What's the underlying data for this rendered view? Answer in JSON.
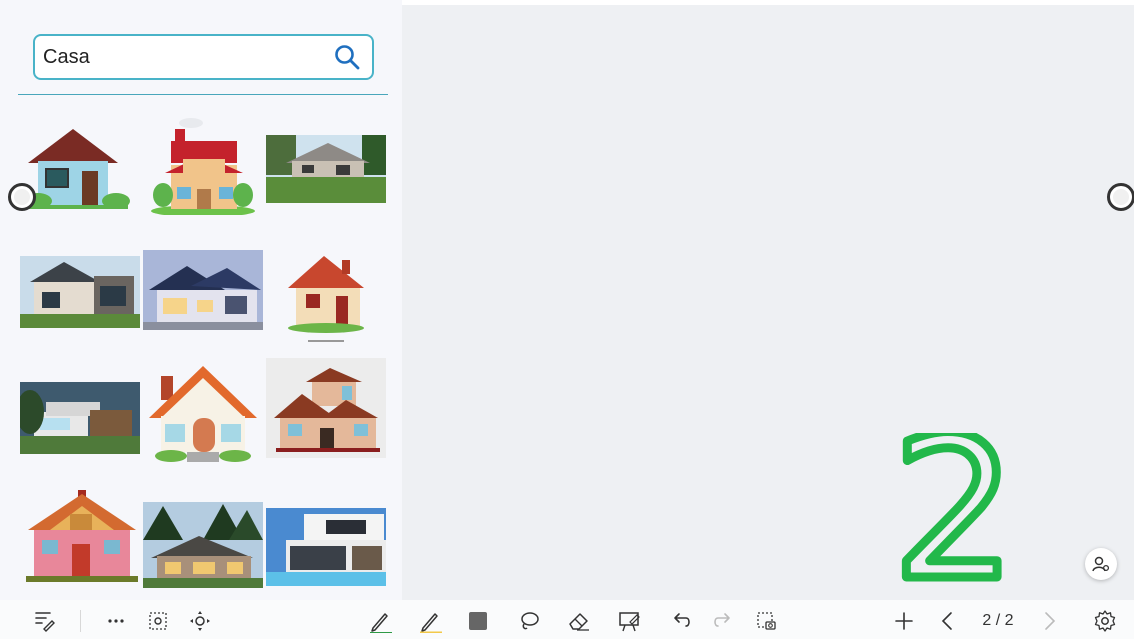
{
  "search": {
    "value": "Casa",
    "icon": "search-icon"
  },
  "results": [
    {
      "name": "image-result-house-blue"
    },
    {
      "name": "image-result-house-red-roof"
    },
    {
      "name": "image-result-house-photo-lawn"
    },
    {
      "name": "image-result-house-modern-solar"
    },
    {
      "name": "image-result-house-blue-dusk"
    },
    {
      "name": "image-result-house-small-cartoon"
    },
    {
      "name": "image-result-house-modern-grey"
    },
    {
      "name": "image-result-house-orange-roof"
    },
    {
      "name": "image-result-house-brown-stacked"
    },
    {
      "name": "image-result-house-wooden-cabin"
    },
    {
      "name": "image-result-house-stone-mountain"
    },
    {
      "name": "image-result-house-modern-pool"
    }
  ],
  "canvas": {
    "annotation": "2",
    "annotation_color": "#22b84a"
  },
  "toolbar": {
    "page_indicator": "2 / 2",
    "pen_color": "#2e9a46",
    "highlighter_color": "#f3c94a"
  }
}
